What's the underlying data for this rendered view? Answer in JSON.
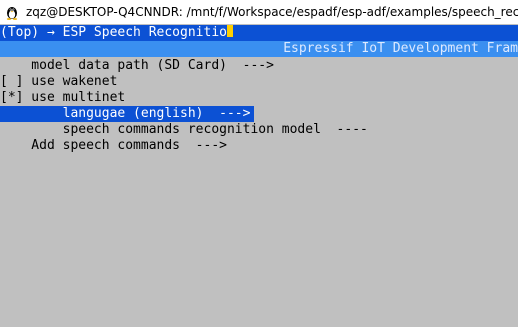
{
  "window": {
    "title": "zqz@DESKTOP-Q4CNNDR: /mnt/f/Workspace/espadf/esp-adf/examples/speech_rec"
  },
  "header": {
    "breadcrumb": "(Top) → ESP Speech Recognitio",
    "brand": "Espressif IoT Development Fram"
  },
  "menu": {
    "items": [
      {
        "text": "    model data path (SD Card)  --->"
      },
      {
        "text": "[ ] use wakenet"
      },
      {
        "text": "[*] use multinet"
      },
      {
        "text": "        langugae (english)  --->"
      },
      {
        "text": "        speech commands recognition model  ----"
      },
      {
        "text": "    Add speech commands  --->"
      }
    ]
  },
  "colors": {
    "background": "#c0c0c0",
    "selection": "#0c51d4",
    "brand_bar": "#3a8ff0",
    "cursor": "#ffd000"
  },
  "icons": {
    "titlebar": "tux-icon"
  }
}
